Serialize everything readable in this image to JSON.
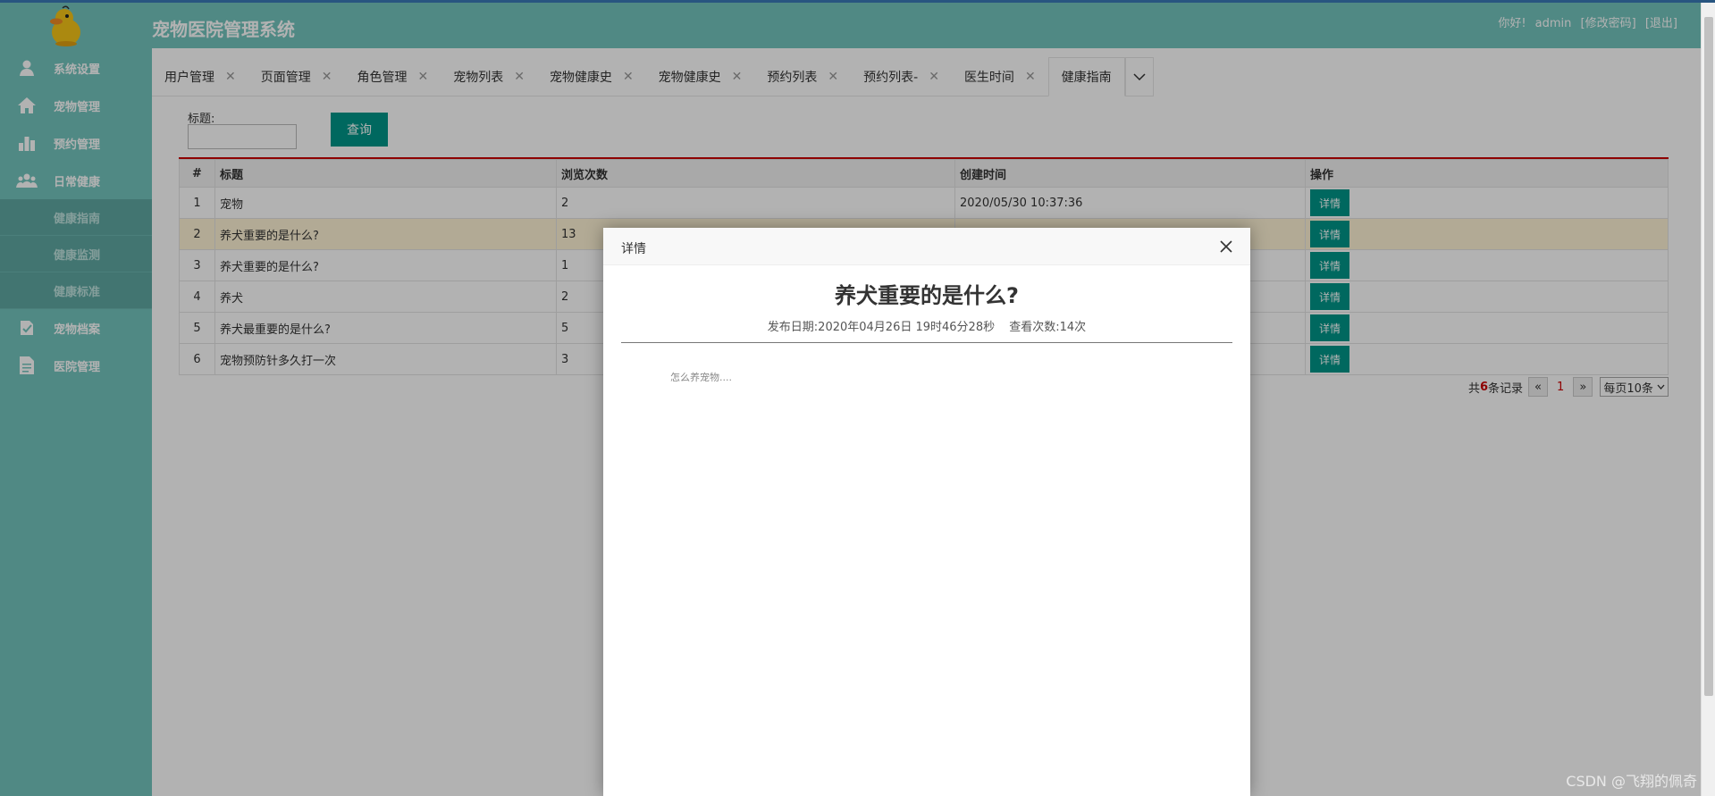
{
  "header": {
    "app_title": "宠物医院管理系统",
    "greeting": "你好!",
    "username": "admin",
    "change_password": "[修改密码]",
    "logout": "[退出]"
  },
  "sidebar": {
    "items": [
      {
        "label": "系统设置",
        "icon": "user-icon"
      },
      {
        "label": "宠物管理",
        "icon": "home-icon"
      },
      {
        "label": "预约管理",
        "icon": "bar-chart-icon"
      },
      {
        "label": "日常健康",
        "icon": "group-icon"
      }
    ],
    "sub_items": [
      "健康指南",
      "健康监测",
      "健康标准"
    ],
    "items_after": [
      {
        "label": "宠物档案",
        "icon": "pet-record-icon"
      },
      {
        "label": "医院管理",
        "icon": "document-icon"
      }
    ]
  },
  "tabs": [
    {
      "label": "用户管理",
      "active": false
    },
    {
      "label": "页面管理",
      "active": false
    },
    {
      "label": "角色管理",
      "active": false
    },
    {
      "label": "宠物列表",
      "active": false
    },
    {
      "label": "宠物健康史",
      "active": false
    },
    {
      "label": "宠物健康史",
      "active": false
    },
    {
      "label": "预约列表",
      "active": false
    },
    {
      "label": "预约列表-",
      "active": false
    },
    {
      "label": "医生时间",
      "active": false
    },
    {
      "label": "健康指南",
      "active": true
    }
  ],
  "search": {
    "label": "标题:",
    "value": "",
    "button": "查询"
  },
  "table": {
    "headers": [
      "#",
      "标题",
      "浏览次数",
      "创建时间",
      "操作"
    ],
    "rows": [
      {
        "num": "1",
        "title": "宠物",
        "views": "2",
        "created": "2020/05/30 10:37:36",
        "action": "详情"
      },
      {
        "num": "2",
        "title": "养犬重要的是什么?",
        "views": "13",
        "created": "",
        "action": "详情"
      },
      {
        "num": "3",
        "title": "养犬重要的是什么?",
        "views": "1",
        "created": "",
        "action": "详情"
      },
      {
        "num": "4",
        "title": "养犬",
        "views": "2",
        "created": "",
        "action": "详情"
      },
      {
        "num": "5",
        "title": "养犬最重要的是什么?",
        "views": "5",
        "created": "",
        "action": "详情"
      },
      {
        "num": "6",
        "title": "宠物预防针多久打一次",
        "views": "3",
        "created": "",
        "action": "详情"
      }
    ]
  },
  "pager": {
    "prefix": "共",
    "count": "6",
    "suffix": "条记录",
    "prev": "«",
    "page": "1",
    "next": "»",
    "per_page": "每页10条"
  },
  "modal": {
    "title": "详情",
    "article_title": "养犬重要的是什么?",
    "publish_date": "发布日期:2020年04月26日 19时46分28秒",
    "views": "查看次数:14次",
    "body": "怎么养宠物...."
  },
  "watermark": "CSDN @飞翔的佩奇",
  "colors": {
    "sidebar": "#73c4bd",
    "primary_button": "#009688",
    "accent_red": "#cc0000"
  }
}
